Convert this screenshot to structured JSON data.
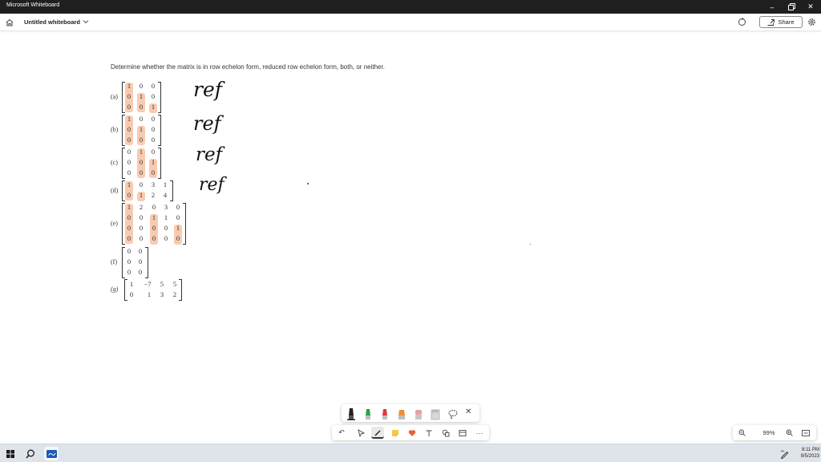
{
  "app": {
    "title": "Microsoft Whiteboard"
  },
  "header": {
    "board_title": "Untitled whiteboard",
    "share_label": "Share"
  },
  "problem": {
    "instruction": "Determine whether the matrix is in row echelon form, reduced row echelon form, both, or neither.",
    "parts": [
      {
        "label": "(a)",
        "rows": [
          [
            "1",
            "0",
            "0"
          ],
          [
            "0",
            "1",
            "0"
          ],
          [
            "0",
            "0",
            "1"
          ]
        ],
        "answer": "ref"
      },
      {
        "label": "(b)",
        "rows": [
          [
            "1",
            "0",
            "0"
          ],
          [
            "0",
            "1",
            "0"
          ],
          [
            "0",
            "0",
            "0"
          ]
        ],
        "answer": "ref"
      },
      {
        "label": "(c)",
        "rows": [
          [
            "0",
            "1",
            "0"
          ],
          [
            "0",
            "0",
            "1"
          ],
          [
            "0",
            "0",
            "0"
          ]
        ],
        "answer": "ref"
      },
      {
        "label": "(d)",
        "rows": [
          [
            "1",
            "0",
            "3",
            "1"
          ],
          [
            "0",
            "1",
            "2",
            "4"
          ]
        ],
        "answer": "ref"
      },
      {
        "label": "(e)",
        "rows": [
          [
            "1",
            "2",
            "0",
            "3",
            "0"
          ],
          [
            "0",
            "0",
            "1",
            "1",
            "0"
          ],
          [
            "0",
            "0",
            "0",
            "0",
            "1"
          ],
          [
            "0",
            "0",
            "0",
            "0",
            "0"
          ]
        ]
      },
      {
        "label": "(f)",
        "rows": [
          [
            "0",
            "0"
          ],
          [
            "0",
            "0"
          ],
          [
            "0",
            "0"
          ]
        ]
      },
      {
        "label": "(g)",
        "rows": [
          [
            "1",
            "−7",
            "5",
            "5"
          ],
          [
            "0",
            "1",
            "3",
            "2"
          ]
        ]
      }
    ]
  },
  "zoom": {
    "level": "99%"
  },
  "taskbar": {
    "time": "8:11 PM",
    "date": "9/5/2023"
  },
  "colors": {
    "titlebar": "#1f1f1f",
    "highlight": "#f08c50",
    "pen_black": "#222222",
    "pen_green": "#2e9e4f",
    "pen_red": "#d83b3b",
    "pen_orange": "#e8913a",
    "pen_pink": "#e8a0a8",
    "taskbar": "#dfe3ea"
  },
  "icons": [
    "home-icon",
    "chevron-down-icon",
    "sync-icon",
    "share-icon",
    "settings-icon",
    "minimize-icon",
    "restore-icon",
    "close-icon",
    "lasso-icon",
    "undo-icon",
    "select-icon",
    "pen-icon",
    "sticky-note-icon",
    "reaction-icon",
    "text-icon",
    "shapes-icon",
    "template-icon",
    "more-icon",
    "zoom-out-icon",
    "zoom-in-icon",
    "fit-to-screen-icon",
    "windows-start-icon",
    "search-icon",
    "whiteboard-app-icon",
    "pen-tray-icon"
  ]
}
